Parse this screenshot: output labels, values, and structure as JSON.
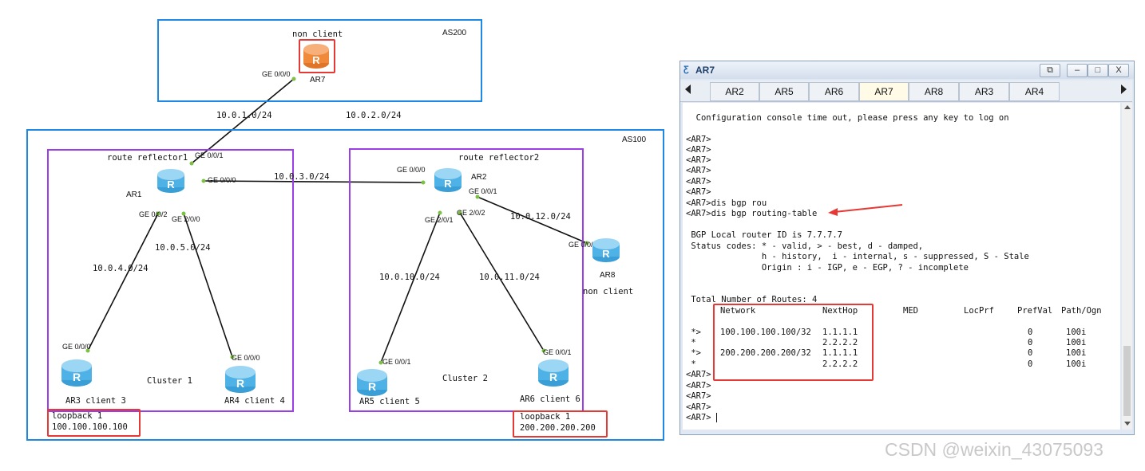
{
  "topology": {
    "as200_label": "AS200",
    "as100_label": "AS100",
    "nonclient_top": "non client",
    "ar7_label": "AR7",
    "ar7_port": "GE 0/0/0",
    "net_10_0_1": "10.0.1.0/24",
    "net_10_0_2": "10.0.2.0/24",
    "rr1_label": "route reflector1",
    "rr2_label": "route reflector2",
    "ar1_label": "AR1",
    "ar2_label": "AR2",
    "ar1_ge001": "GE 0/0/1",
    "ar1_ge000": "GE 0/0/0",
    "ar1_ge002": "GE 0/0/2",
    "ar1_ge200": "GE 2/0/0",
    "net_10_0_3": "10.0.3.0/24",
    "ar2_ge000": "GE 0/0/0",
    "ar2_ge001": "GE 0/0/1",
    "ar2_ge201": "GE 2/0/1",
    "ar2_ge202": "GE 2/0/2",
    "net_10_0_12": "10.0.12.0/24",
    "ar8_port": "GE 0/0/0",
    "ar8_label": "AR8",
    "nonclient_right": "non client",
    "net_10_0_4": "10.0.4.0/24",
    "net_10_0_5": "10.0.5.0/24",
    "net_10_0_10": "10.0.10.0/24",
    "net_10_0_11": "10.0.11.0/24",
    "ar3_port": "GE 0/0/0",
    "ar4_port": "GE 0/0/0",
    "ar5_port": "GE 0/0/1",
    "ar6_port": "GE 0/0/1",
    "cluster1": "Cluster 1",
    "cluster2": "Cluster 2",
    "ar3_label": "AR3 client 3",
    "ar4_label": "AR4 client 4",
    "ar5_label": "AR5 client 5",
    "ar6_label": "AR6 client 6",
    "lb1_title": "loopback 1",
    "lb1_addr": "100.100.100.100",
    "lb2_title": "loopback 1",
    "lb2_addr": "200.200.200.200"
  },
  "window": {
    "title": "AR7",
    "tabs": [
      "AR2",
      "AR5",
      "AR6",
      "AR7",
      "AR8",
      "AR3",
      "AR4"
    ],
    "active_tab": "AR7",
    "btn_restore": "⧉",
    "btn_min": "–",
    "btn_max": "□",
    "btn_close": "X"
  },
  "terminal": {
    "timeout": "  Configuration console time out, please press any key to log on",
    "prompts_before": [
      "<AR7>",
      "<AR7>",
      "<AR7>",
      "<AR7>",
      "<AR7>",
      "<AR7>"
    ],
    "cmd1": "<AR7>dis bgp rou",
    "cmd2": "<AR7>dis bgp routing-table",
    "router_id": " BGP Local router ID is 7.7.7.7",
    "status1": " Status codes: * - valid, > - best, d - damped,",
    "status2": "               h - history,  i - internal, s - suppressed, S - Stale",
    "status3": "               Origin : i - IGP, e - EGP, ? - incomplete",
    "total": " Total Number of Routes: 4",
    "headers": [
      "Network",
      "NextHop",
      "MED",
      "LocPrf",
      "PrefVal",
      "Path/Ogn"
    ],
    "routes": [
      {
        "flag": " *>",
        "network": "100.100.100.100/32",
        "nexthop": "1.1.1.1",
        "prefval": "0",
        "path": "100i"
      },
      {
        "flag": " *",
        "network": "",
        "nexthop": "2.2.2.2",
        "prefval": "0",
        "path": "100i"
      },
      {
        "flag": " *>",
        "network": "200.200.200.200/32",
        "nexthop": "1.1.1.1",
        "prefval": "0",
        "path": "100i"
      },
      {
        "flag": " *",
        "network": "",
        "nexthop": "2.2.2.2",
        "prefval": "0",
        "path": "100i"
      }
    ],
    "prompts_after": [
      "<AR7>",
      "<AR7>",
      "<AR7>",
      "<AR7>",
      "<AR7>"
    ]
  },
  "watermark": "CSDN @weixin_43075093"
}
